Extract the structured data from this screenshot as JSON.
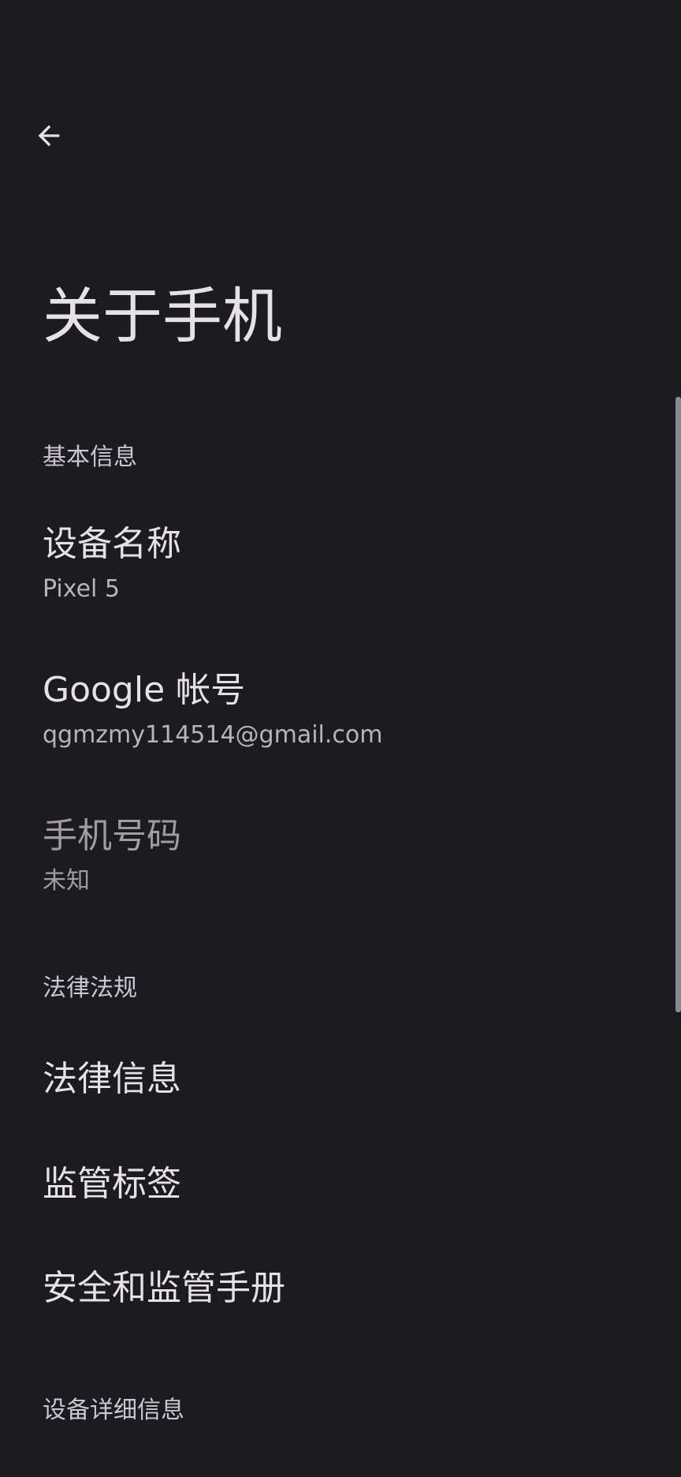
{
  "header": {
    "back_icon": "arrow-left-icon",
    "title": "关于手机"
  },
  "sections": {
    "basic": {
      "header": "基本信息",
      "device_name": {
        "title": "设备名称",
        "summary": "Pixel 5"
      },
      "google_account": {
        "title": "Google 帐号",
        "summary": "qgmzmy114514@gmail.com"
      },
      "phone_number": {
        "title": "手机号码",
        "summary": "未知"
      }
    },
    "legal": {
      "header": "法律法规",
      "legal_info": {
        "title": "法律信息"
      },
      "regulatory_labels": {
        "title": "监管标签"
      },
      "safety_manual": {
        "title": "安全和监管手册"
      }
    },
    "device_details": {
      "header": "设备详细信息"
    }
  },
  "colors": {
    "background": "#1c1b20",
    "text_primary": "#e6e1e6",
    "text_secondary": "#b9b4bb",
    "text_disabled": "#a19ca3",
    "section_header": "#ccc5d6"
  }
}
